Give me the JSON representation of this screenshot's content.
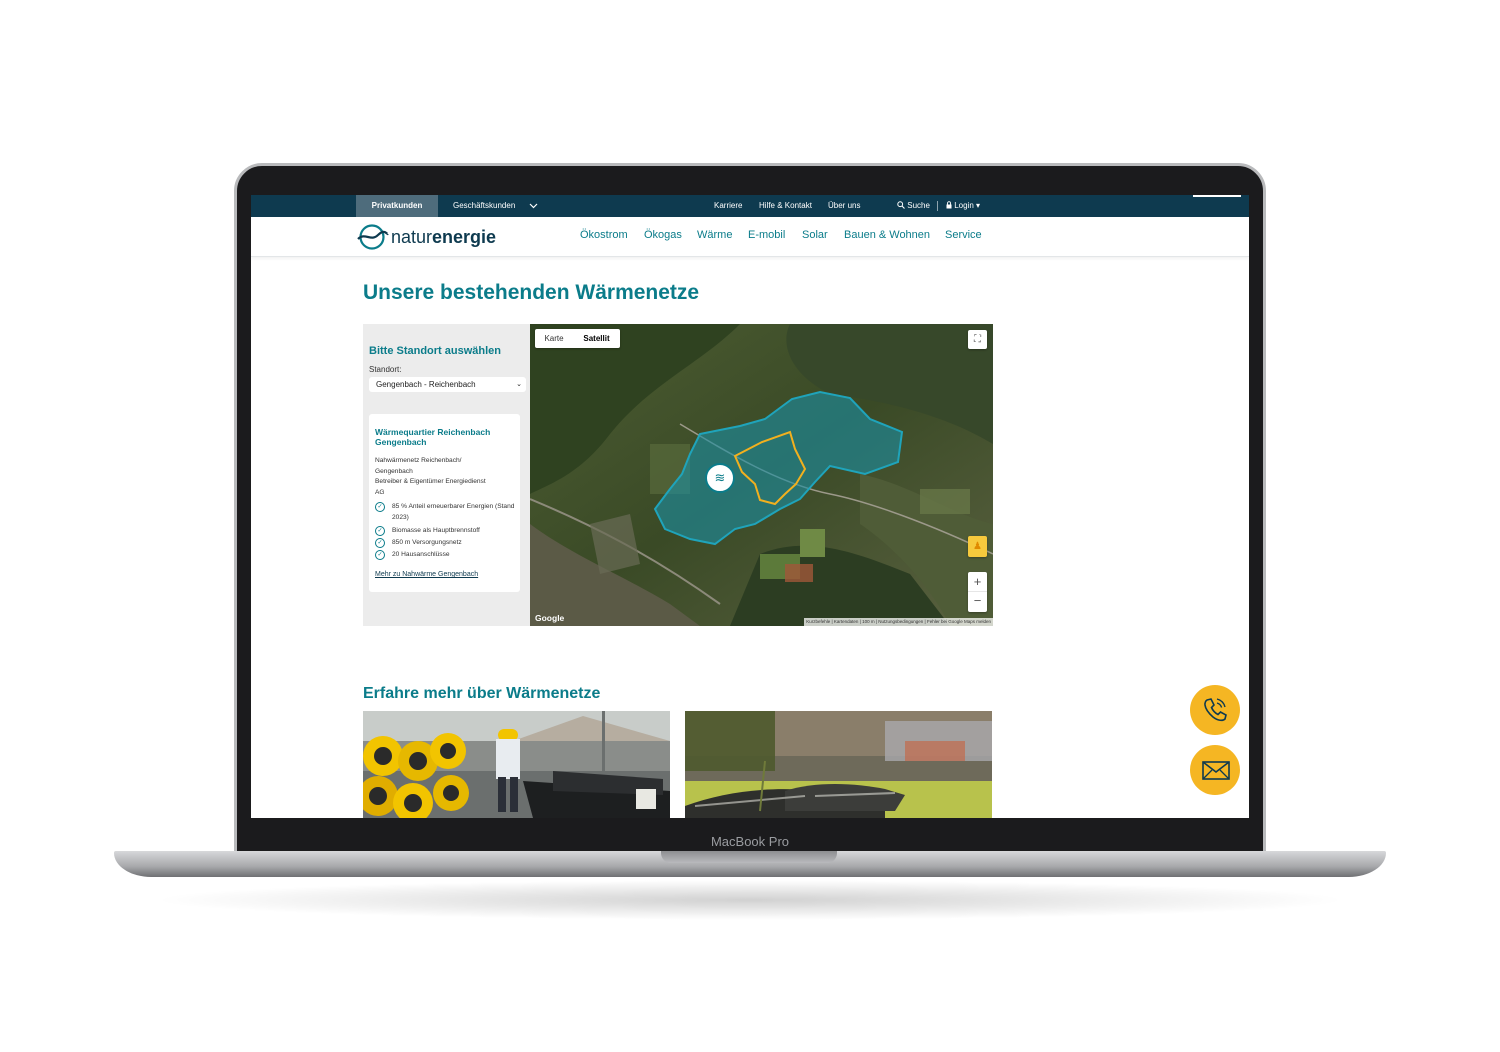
{
  "device": {
    "label": "MacBook Pro"
  },
  "topbar": {
    "tab_active": "Privatkunden",
    "tab_other": "Geschäftskunden",
    "links": [
      "Karriere",
      "Hilfe & Kontakt",
      "Über uns"
    ],
    "search": "Suche",
    "login": "Login"
  },
  "brand": {
    "name_light": "natur",
    "name_bold": "energie"
  },
  "nav": [
    "Ökostrom",
    "Ökogas",
    "Wärme",
    "E-mobil",
    "Solar",
    "Bauen & Wohnen",
    "Service"
  ],
  "page": {
    "title": "Unsere bestehenden Wärmenetze",
    "section2_title": "Erfahre mehr über Wärmenetze"
  },
  "locator": {
    "heading": "Bitte Standort auswählen",
    "label": "Standort:",
    "selected": "Gengenbach - Reichenbach",
    "card": {
      "title": "Wärmequartier Reichenbach Gengenbach",
      "desc_line1": "Nahwärmenetz Reichenbach/",
      "desc_line2": "Gengenbach",
      "desc_line3": "Betreiber & Eigentümer Energiedienst",
      "desc_line4": "AG",
      "features": [
        "85 % Anteil erneuerbarer Energien (Stand 2023)",
        "Biomasse als Hauptbrennstoff",
        "850 m Versorgungsnetz",
        "20 Hausanschlüsse"
      ],
      "link": "Mehr zu Nahwärme Gengenbach"
    }
  },
  "map": {
    "type_options": [
      "Karte",
      "Satellit"
    ],
    "type_selected": "Satellit",
    "google": "Google",
    "attribution": "Kurzbefehle  |  Kartendaten  |  100 m  |  Nutzungsbedingungen  |  Fehler bei Google Maps melden",
    "zoom_in": "+",
    "zoom_out": "−",
    "colors": {
      "area": "#1b8fa3",
      "line": "#f2b01e"
    }
  },
  "contact": {
    "phone_icon": "phone-icon",
    "mail_icon": "mail-icon",
    "accent": "#f5b623"
  }
}
